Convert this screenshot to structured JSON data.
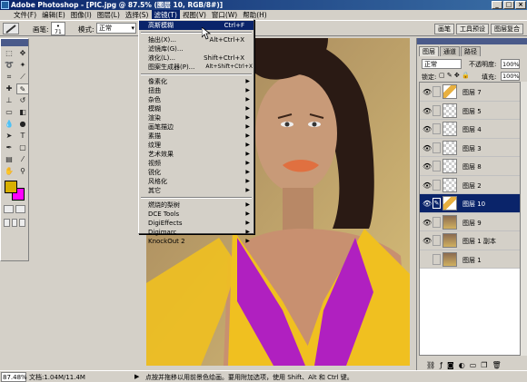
{
  "window": {
    "title": "Adobe Photoshop - [PIC.jpg @ 87.5% (图层 10, RGB/8#)]",
    "buttons": [
      "_",
      "□",
      "×"
    ]
  },
  "menubar": {
    "items": [
      "文件(F)",
      "编辑(E)",
      "图像(I)",
      "图层(L)",
      "选择(S)",
      "滤镜(T)",
      "视图(V)",
      "窗口(W)",
      "帮助(H)"
    ],
    "active": "滤镜(T)"
  },
  "options": {
    "brush_label": "画笔:",
    "brush_size": "71",
    "mode_label": "模式:",
    "mode_value": "正常"
  },
  "palette_well": [
    "画笔",
    "工具预设",
    "图层复合"
  ],
  "filter_menu": {
    "items": [
      {
        "label": "高斯模糊",
        "shortcut": "Ctrl+F",
        "highlight": true
      },
      {
        "sep": true
      },
      {
        "label": "抽出(X)...",
        "shortcut": "Alt+Ctrl+X"
      },
      {
        "label": "滤镜库(G)..."
      },
      {
        "label": "液化(L)...",
        "shortcut": "Shift+Ctrl+X"
      },
      {
        "label": "图案生成器(P)...",
        "shortcut": "Alt+Shift+Ctrl+X"
      },
      {
        "sep": true
      },
      {
        "label": "像素化",
        "submenu": true
      },
      {
        "label": "扭曲",
        "submenu": true
      },
      {
        "label": "杂色",
        "submenu": true
      },
      {
        "label": "模糊",
        "submenu": true
      },
      {
        "label": "渲染",
        "submenu": true
      },
      {
        "label": "画笔描边",
        "submenu": true
      },
      {
        "label": "素描",
        "submenu": true
      },
      {
        "label": "纹理",
        "submenu": true
      },
      {
        "label": "艺术效果",
        "submenu": true
      },
      {
        "label": "视频",
        "submenu": true
      },
      {
        "label": "锐化",
        "submenu": true
      },
      {
        "label": "风格化",
        "submenu": true
      },
      {
        "label": "其它",
        "submenu": true
      },
      {
        "sep": true
      },
      {
        "label": "燃烧的梨树",
        "submenu": true
      },
      {
        "label": "DCE Tools",
        "submenu": true
      },
      {
        "label": "DigiEffects",
        "submenu": true
      },
      {
        "label": "Digimarc",
        "submenu": true
      },
      {
        "label": "KnockOut 2",
        "submenu": true
      }
    ]
  },
  "layers_panel": {
    "tabs": [
      "图层",
      "通道",
      "路径"
    ],
    "blend_mode": "正常",
    "opacity_label": "不透明度:",
    "opacity": "100%",
    "lock_label": "锁定:",
    "fill_label": "填充:",
    "fill": "100%",
    "layers": [
      {
        "name": "图层 7",
        "thumb": "yel",
        "selected": false
      },
      {
        "name": "图层 5",
        "thumb": "check",
        "selected": false
      },
      {
        "name": "图层 4",
        "thumb": "check",
        "selected": false
      },
      {
        "name": "图层 3",
        "thumb": "check",
        "selected": false
      },
      {
        "name": "图层 8",
        "thumb": "check",
        "selected": false
      },
      {
        "name": "图层 2",
        "thumb": "check",
        "selected": false
      },
      {
        "name": "图层 10",
        "thumb": "yel",
        "selected": true
      },
      {
        "name": "图层 9",
        "thumb": "img",
        "selected": false
      },
      {
        "name": "图层 1 副本",
        "thumb": "img",
        "selected": false
      },
      {
        "name": "图层 1",
        "thumb": "img",
        "selected": false
      }
    ]
  },
  "status": {
    "zoom": "87.48%",
    "doc_size": "文档:1.04M/11.4M",
    "hint": "点按并拖移以用前景色绘画。要用附加选项，使用 Shift、Alt 和 Ctrl 键。"
  },
  "colors": {
    "foreground": "#d8b000",
    "background": "#ff00ff",
    "accent": "#0a246a"
  }
}
